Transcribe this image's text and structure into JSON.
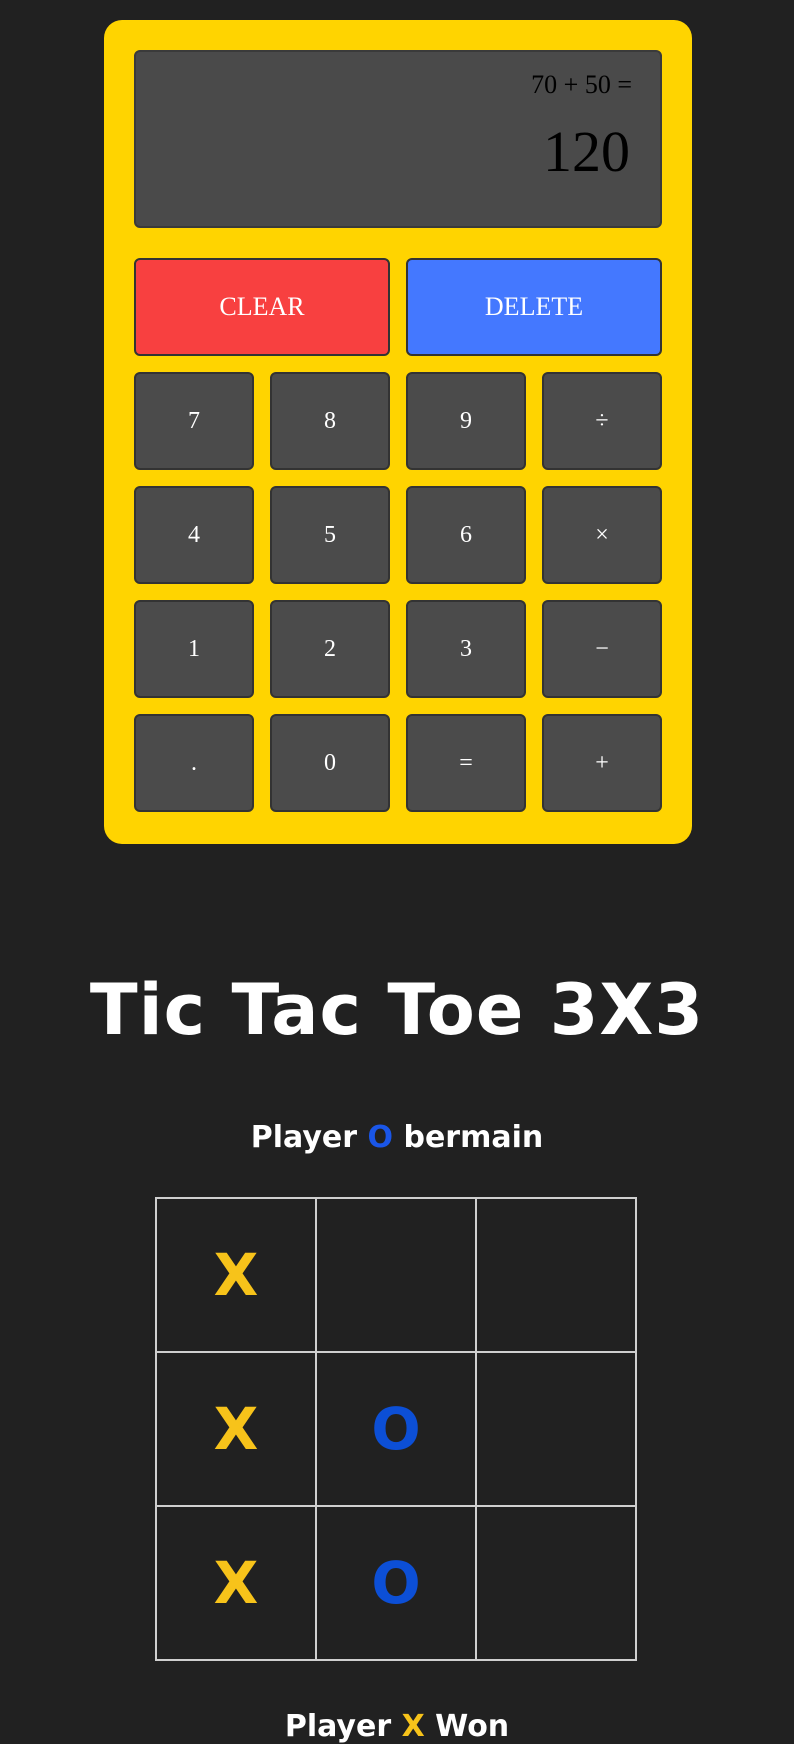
{
  "calculator": {
    "display": {
      "expression": "70 + 50 =",
      "result": "120"
    },
    "clear_label": "CLEAR",
    "delete_label": "DELETE",
    "keys": [
      [
        "7",
        "8",
        "9",
        "÷"
      ],
      [
        "4",
        "5",
        "6",
        "×"
      ],
      [
        "1",
        "2",
        "3",
        "−"
      ],
      [
        ".",
        "0",
        "=",
        "+"
      ]
    ]
  },
  "tictactoe": {
    "title": "Tic Tac Toe 3X3",
    "turn_prefix": "Player",
    "turn_mark": "O",
    "turn_suffix": "bermain",
    "board": [
      [
        "X",
        "",
        ""
      ],
      [
        "X",
        "O",
        ""
      ],
      [
        "X",
        "O",
        ""
      ]
    ],
    "result_prefix": "Player",
    "result_mark": "X",
    "result_suffix": "Won"
  },
  "colors": {
    "background": "#212121",
    "calculator_body": "#ffd400",
    "clear_button": "#f84040",
    "delete_button": "#4478ff",
    "x_mark": "#f7c31a",
    "o_mark": "#0c4fd6"
  }
}
